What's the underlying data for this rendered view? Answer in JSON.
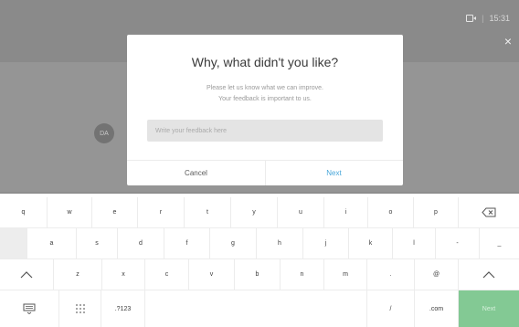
{
  "header": {
    "app_title": "",
    "time": "15:31",
    "separator": "|"
  },
  "icons": {
    "camera": "camera-icon",
    "close": "close-icon",
    "backspace": "backspace-icon",
    "shift": "shift-icon",
    "keyboard": "keyboard-icon",
    "dialpad": "dialpad-icon"
  },
  "close_glyph": "×",
  "avatar_initials": "DA",
  "dialog": {
    "title": "Why, what didn't you like?",
    "subtitle_line1": "Please let us know what we can improve.",
    "subtitle_line2": "Your feedback is important to us.",
    "input_placeholder": "Write your feedback here",
    "input_value": "",
    "cancel_label": "Cancel",
    "next_label": "Next"
  },
  "keyboard": {
    "row1": [
      "q",
      "w",
      "e",
      "r",
      "t",
      "y",
      "u",
      "i",
      "o",
      "p"
    ],
    "row2": [
      "a",
      "s",
      "d",
      "f",
      "g",
      "h",
      "j",
      "k",
      "l",
      "-",
      "_"
    ],
    "row3": [
      "z",
      "x",
      "c",
      "v",
      "b",
      "n",
      "m",
      ".",
      "@"
    ],
    "numeric_label": ".?123",
    "slash_label": "/",
    "com_label": ".com",
    "next_key_label": "Next"
  },
  "colors": {
    "accent_blue": "#47a6d9",
    "next_key_green": "#83c994"
  }
}
